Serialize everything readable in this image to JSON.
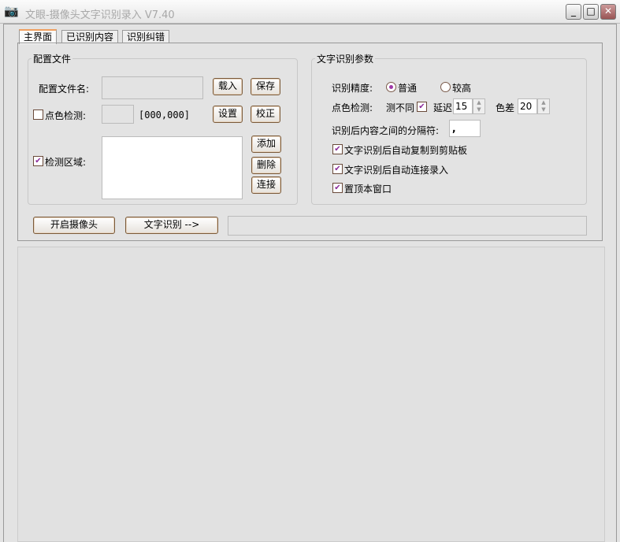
{
  "window": {
    "title": "文眼-摄像头文字识别录入 V7.40",
    "icon": "camera-tripod-icon",
    "minimize": "_",
    "maximize": "□",
    "close": "✕"
  },
  "tabs": [
    {
      "label": "主界面",
      "active": true
    },
    {
      "label": "已识别内容",
      "active": false
    },
    {
      "label": "识别纠错",
      "active": false
    }
  ],
  "config": {
    "legend": "配置文件",
    "filename_label": "配置文件名:",
    "filename_value": "",
    "load": "载入",
    "save": "保存",
    "color_check_label": "点色检测:",
    "color_check_checked": false,
    "coord": "[000,000]",
    "set": "设置",
    "calibrate": "校正",
    "region_label": "检测区域:",
    "region_checked": true,
    "add": "添加",
    "delete": "删除",
    "connect": "连接"
  },
  "ocr": {
    "legend": "文字识别参数",
    "precision_label": "识别精度:",
    "normal": "普通",
    "high": "较高",
    "selected": "普通",
    "color_label": "点色检测:",
    "diff_label": "测不同",
    "diff_checked": true,
    "delay_label": "延迟",
    "delay_value": "15",
    "tolerance_label": "色差",
    "tolerance_value": "20",
    "separator_label": "识别后内容之间的分隔符:",
    "separator_value": ",",
    "opt_copy": "文字识别后自动复制到剪贴板",
    "opt_copy_checked": true,
    "opt_auto": "文字识别后自动连接录入",
    "opt_auto_checked": true,
    "opt_top": "置顶本窗口",
    "opt_top_checked": true
  },
  "actions": {
    "camera": "开启摄像头",
    "recognize": "文字识别 -->",
    "status": ""
  }
}
